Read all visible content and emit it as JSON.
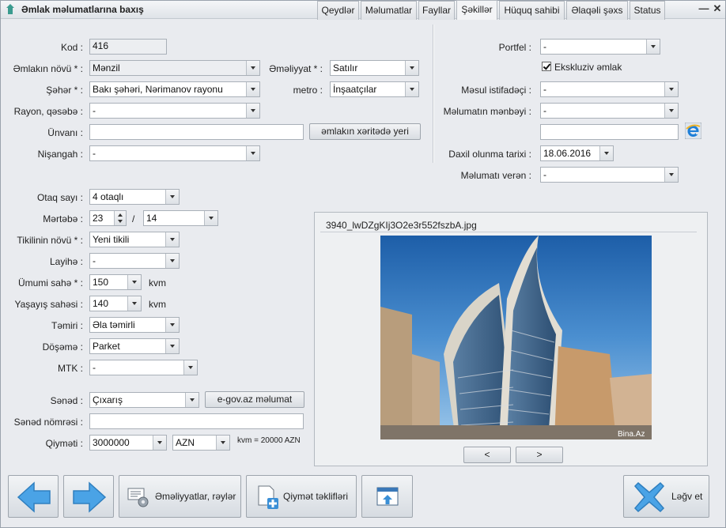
{
  "window": {
    "title": "Əmlak məlumatlarına baxış"
  },
  "left": {
    "kod": {
      "label": "Kod :",
      "value": "416"
    },
    "emlak_novu": {
      "label": "Əmlakın növü * :",
      "value": "Mənzil"
    },
    "emeliyyat": {
      "label": "Əməliyyat * :",
      "value": "Satılır"
    },
    "seher": {
      "label": "Şəhər * :",
      "value": "Bakı şəhəri, Nərimanov rayonu"
    },
    "metro": {
      "label": "metro :",
      "value": "İnşaatçılar"
    },
    "rayon": {
      "label": "Rayon, qəsəbə :",
      "value": "-"
    },
    "unvan": {
      "label": "Ünvanı :",
      "value": ""
    },
    "xerite_button": "əmlakın xəritədə yeri",
    "nisangah": {
      "label": "Nişangah :",
      "value": "-"
    },
    "otaq": {
      "label": "Otaq sayı :",
      "value": "4 otaqlı"
    },
    "mertebe": {
      "label": "Mərtəbə :",
      "value": "23",
      "slash": "/",
      "total": "14"
    },
    "tikili": {
      "label": "Tikilinin növü * :",
      "value": "Yeni tikili"
    },
    "layihe": {
      "label": "Layihə :",
      "value": "-"
    },
    "umumi": {
      "label": "Ümumi sahə * :",
      "value": "150",
      "unit": "kvm"
    },
    "yasayis": {
      "label": "Yaşayış sahəsi :",
      "value": "140",
      "unit": "kvm"
    },
    "temir": {
      "label": "Təmiri :",
      "value": "Əla təmirli"
    },
    "doseme": {
      "label": "Döşəmə :",
      "value": "Parket"
    },
    "mtk": {
      "label": "MTK :",
      "value": "-"
    },
    "sened": {
      "label": "Sənəd :",
      "value": "Çıxarış"
    },
    "egov_button": "e-gov.az məlumat",
    "sened_nomresi": {
      "label": "Sənəd nömrəsi :",
      "value": ""
    },
    "qiymet": {
      "label": "Qiyməti :",
      "value": "3000000",
      "currency": "AZN",
      "note": "kvm = 20000 AZN"
    }
  },
  "right": {
    "portfel": {
      "label": "Portfel :",
      "value": "-"
    },
    "ekskluziv": {
      "label": "Ekskluziv əmlak",
      "checked": true
    },
    "mesul": {
      "label": "Məsul istifadəçi :",
      "value": "-"
    },
    "menbe": {
      "label": "Məlumatın mənbəyi :",
      "value": "-",
      "extra": ""
    },
    "daxil": {
      "label": "Daxil olunma tarixi :",
      "value": "18.06.2016"
    },
    "veren": {
      "label": "Məlumatı verən :",
      "value": "-"
    }
  },
  "tabs": [
    "Qeydlər",
    "Məlumatlar",
    "Fayllar",
    "Şəkillər",
    "Hüquq sahibi",
    "Əlaqəli şəxs",
    "Status"
  ],
  "active_tab": 3,
  "photo": {
    "filename": "3940_lwDZgKIj3O2e3r552fszbA.jpg",
    "watermark": "Bina.Az",
    "prev": "<",
    "next": ">"
  },
  "bottom": {
    "operations_button": "Əməliyyatlar, rəylər",
    "price_offers_button": "Qiymət təklifləri",
    "cancel_button": "Ləğv et"
  },
  "colors": {
    "accent_blue": "#3a8fd6",
    "background": "#e9ebef"
  }
}
